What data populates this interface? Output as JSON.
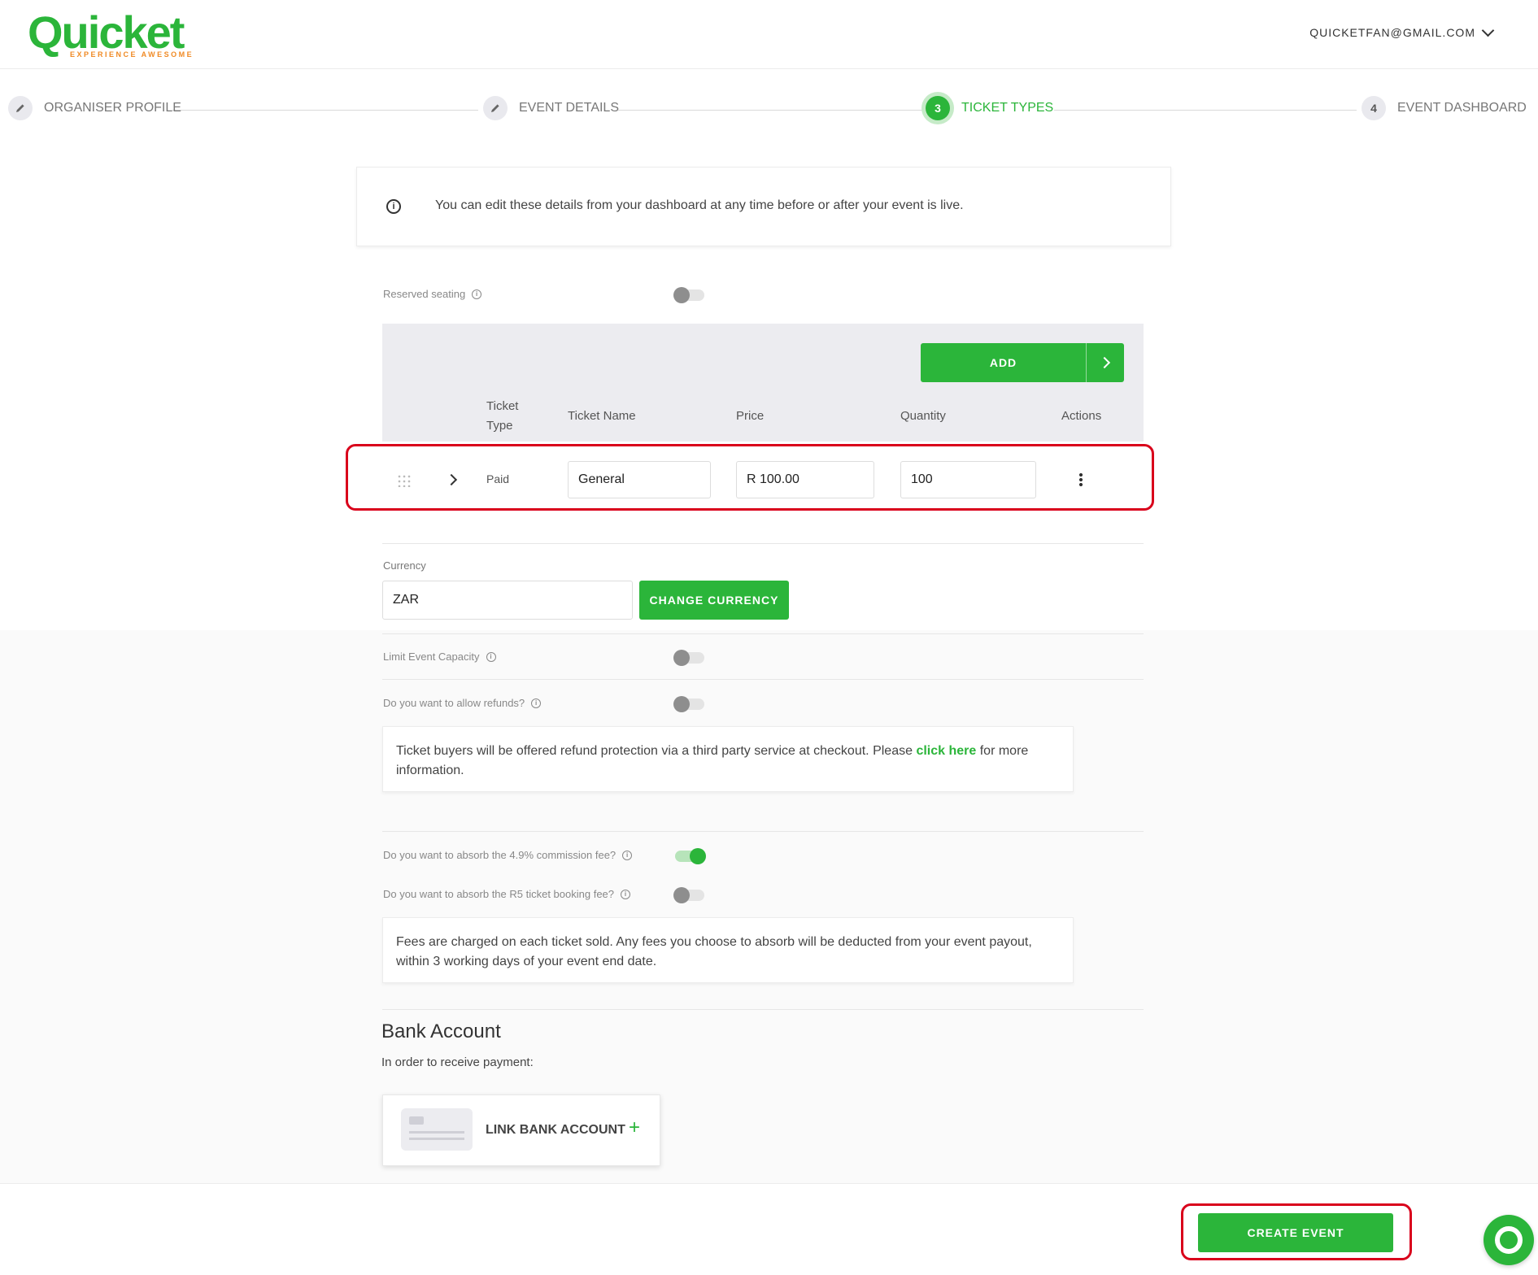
{
  "header": {
    "logo_text": "Quicket",
    "logo_tagline": "EXPERIENCE AWESOME",
    "account_email": "QUICKETFAN@GMAIL.COM"
  },
  "stepper": {
    "steps": [
      {
        "marker": "edit-icon",
        "label": "ORGANISER PROFILE"
      },
      {
        "marker": "edit-icon",
        "label": "EVENT DETAILS"
      },
      {
        "marker": "3",
        "label": "TICKET TYPES",
        "active": true
      },
      {
        "marker": "4",
        "label": "EVENT DASHBOARD"
      }
    ]
  },
  "info_banner": {
    "text": "You can edit these details from your dashboard at any time before or after your event is live."
  },
  "reserved_seating": {
    "label": "Reserved seating",
    "enabled": false
  },
  "tickets": {
    "add_label": "ADD",
    "columns": {
      "type": "Ticket Type",
      "name": "Ticket Name",
      "price": "Price",
      "quantity": "Quantity",
      "actions": "Actions"
    },
    "rows": [
      {
        "type": "Paid",
        "name": "General",
        "price": "R 100.00",
        "quantity": "100"
      }
    ]
  },
  "currency": {
    "label": "Currency",
    "value": "ZAR",
    "change_label": "CHANGE CURRENCY"
  },
  "limit_capacity": {
    "label": "Limit Event Capacity",
    "enabled": false
  },
  "refunds": {
    "label": "Do you want to allow refunds?",
    "enabled": false,
    "note_prefix": "Ticket buyers will be offered refund protection via a third party service at checkout. Please",
    "note_link": "click here",
    "note_suffix": "for more information."
  },
  "fees": {
    "commission_label": "Do you want to absorb the 4.9% commission fee?",
    "commission_enabled": true,
    "booking_label": "Do you want to absorb the R5 ticket booking fee?",
    "booking_enabled": false,
    "note": "Fees are charged on each ticket sold. Any fees you choose to absorb will be deducted from your event payout, within 3 working days of your event end date."
  },
  "bank": {
    "title": "Bank Account",
    "subtitle": "In order to receive payment:",
    "link_label": "LINK BANK ACCOUNT",
    "plus": "+"
  },
  "footer": {
    "create_label": "CREATE EVENT"
  },
  "colors": {
    "brand_green": "#2bb53a",
    "logo_tag_orange": "#f08a24",
    "highlight_red": "#d9001b"
  }
}
